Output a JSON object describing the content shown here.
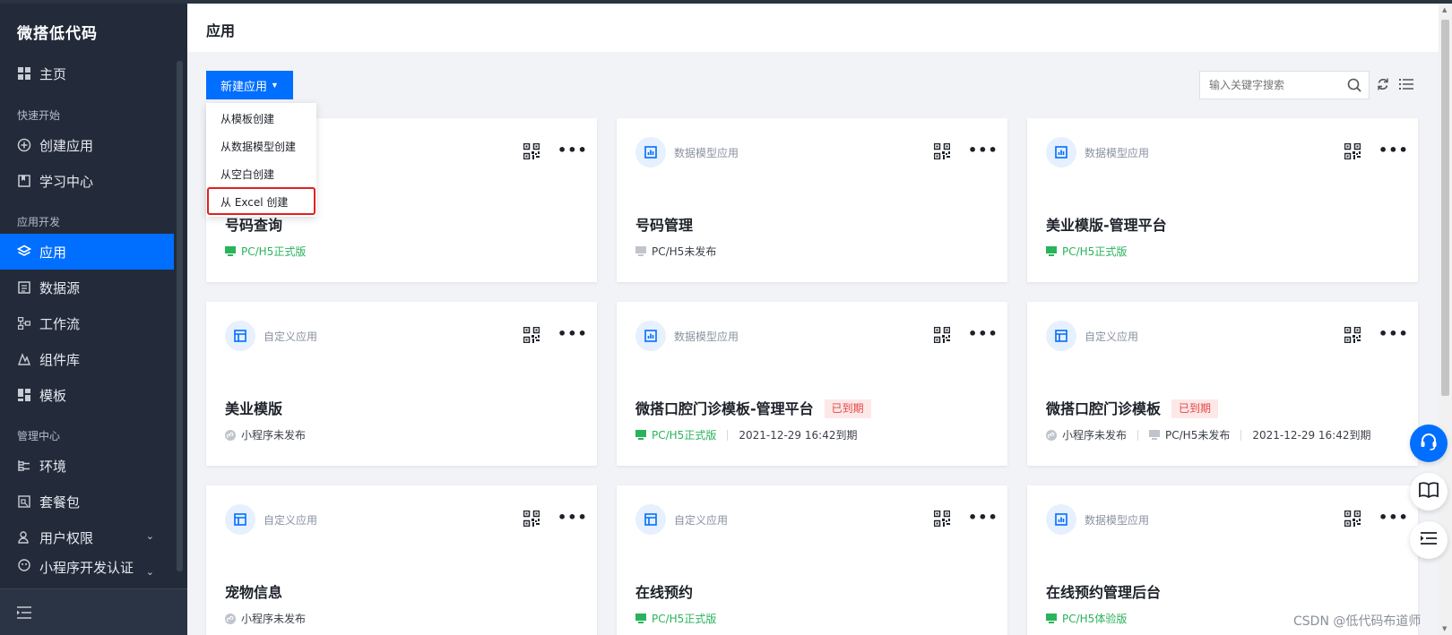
{
  "sidebar": {
    "brand": "微搭低代码",
    "items": [
      {
        "label": "主页",
        "icon": "grid-icon"
      },
      {
        "label": "创建应用",
        "icon": "plus-circle-icon"
      },
      {
        "label": "学习中心",
        "icon": "book-icon"
      },
      {
        "label": "应用",
        "icon": "layers-icon",
        "active": true
      },
      {
        "label": "数据源",
        "icon": "database-icon"
      },
      {
        "label": "工作流",
        "icon": "workflow-icon"
      },
      {
        "label": "组件库",
        "icon": "component-icon"
      },
      {
        "label": "模板",
        "icon": "template-icon"
      },
      {
        "label": "环境",
        "icon": "environment-icon"
      },
      {
        "label": "套餐包",
        "icon": "package-icon"
      },
      {
        "label": "用户权限",
        "icon": "user-icon"
      },
      {
        "label": "小程序开发认证",
        "icon": "miniprogram-icon"
      }
    ],
    "sections": [
      "快速开始",
      "应用开发",
      "管理中心"
    ]
  },
  "header": {
    "title": "应用"
  },
  "toolbar": {
    "new_app_label": "新建应用",
    "search_placeholder": "输入关键字搜索"
  },
  "dropdown": {
    "items": [
      "从模板创建",
      "从数据模型创建",
      "从空白创建",
      "从 Excel 创建"
    ],
    "highlighted_index": 3
  },
  "cards": [
    {
      "type": "",
      "name": "号码查询",
      "statuses": [
        {
          "text": "PC/H5正式版",
          "color": "green",
          "icon": "monitor-icon"
        }
      ]
    },
    {
      "type": "数据模型应用",
      "name": "号码管理",
      "statuses": [
        {
          "text": "PC/H5未发布",
          "color": "gray",
          "icon": "monitor-icon"
        }
      ]
    },
    {
      "type": "数据模型应用",
      "name": "美业模版-管理平台",
      "statuses": [
        {
          "text": "PC/H5正式版",
          "color": "green",
          "icon": "monitor-icon"
        }
      ]
    },
    {
      "type": "自定义应用",
      "name": "美业模版",
      "statuses": [
        {
          "text": "小程序未发布",
          "color": "gray",
          "icon": "miniprogram-icon"
        }
      ]
    },
    {
      "type": "数据模型应用",
      "name": "微搭口腔门诊模板-管理平台",
      "badge": "已到期",
      "statuses": [
        {
          "text": "PC/H5正式版",
          "color": "green",
          "icon": "monitor-icon"
        },
        {
          "text": "2021-12-29 16:42到期",
          "color": "gray",
          "icon": ""
        }
      ]
    },
    {
      "type": "自定义应用",
      "name": "微搭口腔门诊模板",
      "badge": "已到期",
      "statuses": [
        {
          "text": "小程序未发布",
          "color": "gray",
          "icon": "miniprogram-icon"
        },
        {
          "text": "PC/H5未发布",
          "color": "gray",
          "icon": "monitor-icon"
        },
        {
          "text": "2021-12-29 16:42到期",
          "color": "gray",
          "icon": ""
        }
      ]
    },
    {
      "type": "自定义应用",
      "name": "宠物信息",
      "statuses": [
        {
          "text": "小程序未发布",
          "color": "gray",
          "icon": "miniprogram-icon"
        }
      ]
    },
    {
      "type": "自定义应用",
      "name": "在线预约",
      "statuses": [
        {
          "text": "PC/H5正式版",
          "color": "green",
          "icon": "monitor-icon"
        }
      ]
    },
    {
      "type": "数据模型应用",
      "name": "在线预约管理后台",
      "statuses": [
        {
          "text": "PC/H5体验版",
          "color": "green",
          "icon": "monitor-icon"
        }
      ]
    }
  ],
  "watermark": "CSDN @低代码布道师",
  "colors": {
    "accent": "#006eff",
    "sidebar": "#232b3a",
    "success": "#29b35b",
    "danger": "#e54545"
  }
}
